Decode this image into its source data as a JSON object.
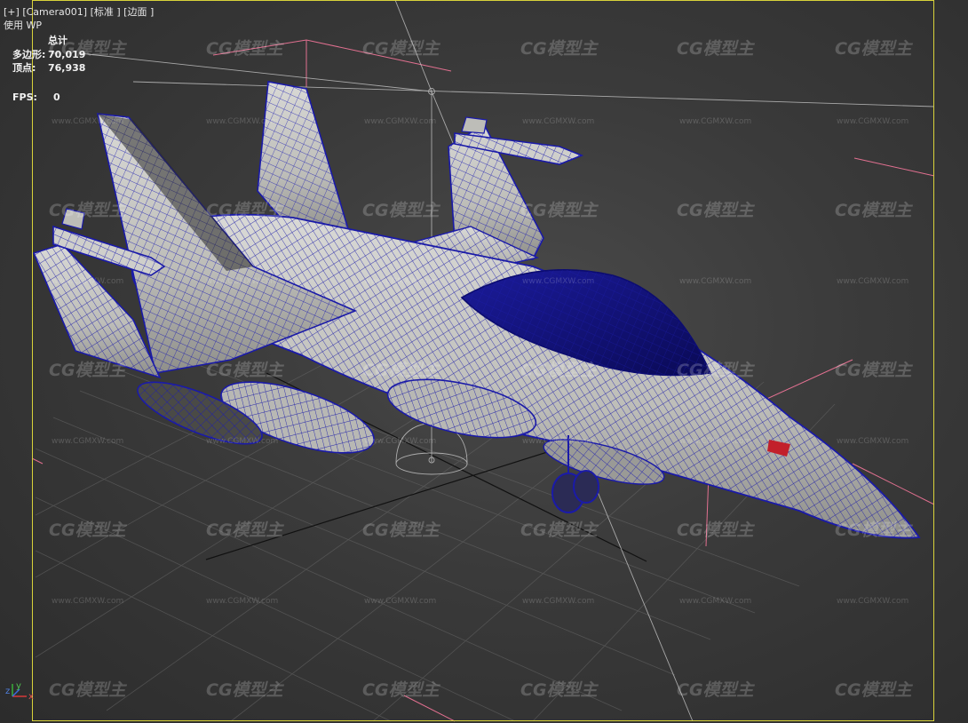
{
  "viewport_label": {
    "plus": "[+]",
    "camera": "[Camera001]",
    "shading": "[标准 ]",
    "mode": "[边面 ]"
  },
  "viewport_sub": "使用 WP",
  "stats": {
    "header": "总计",
    "polys_label": "多边形:",
    "polys_value": "70,019",
    "verts_label": "顶点:",
    "verts_value": "76,938",
    "fps_label": "FPS:",
    "fps_value": "0"
  },
  "watermark": {
    "logo": "CG模型主",
    "url": "www.CGMXW.com"
  },
  "axis": {
    "x": "x",
    "y": "y",
    "z": "z"
  },
  "colors": {
    "frame": "#d8d23a",
    "wire": "#1a1aa8",
    "grid": "#6a6a6a",
    "camera_lines": "#ff7aa0"
  }
}
